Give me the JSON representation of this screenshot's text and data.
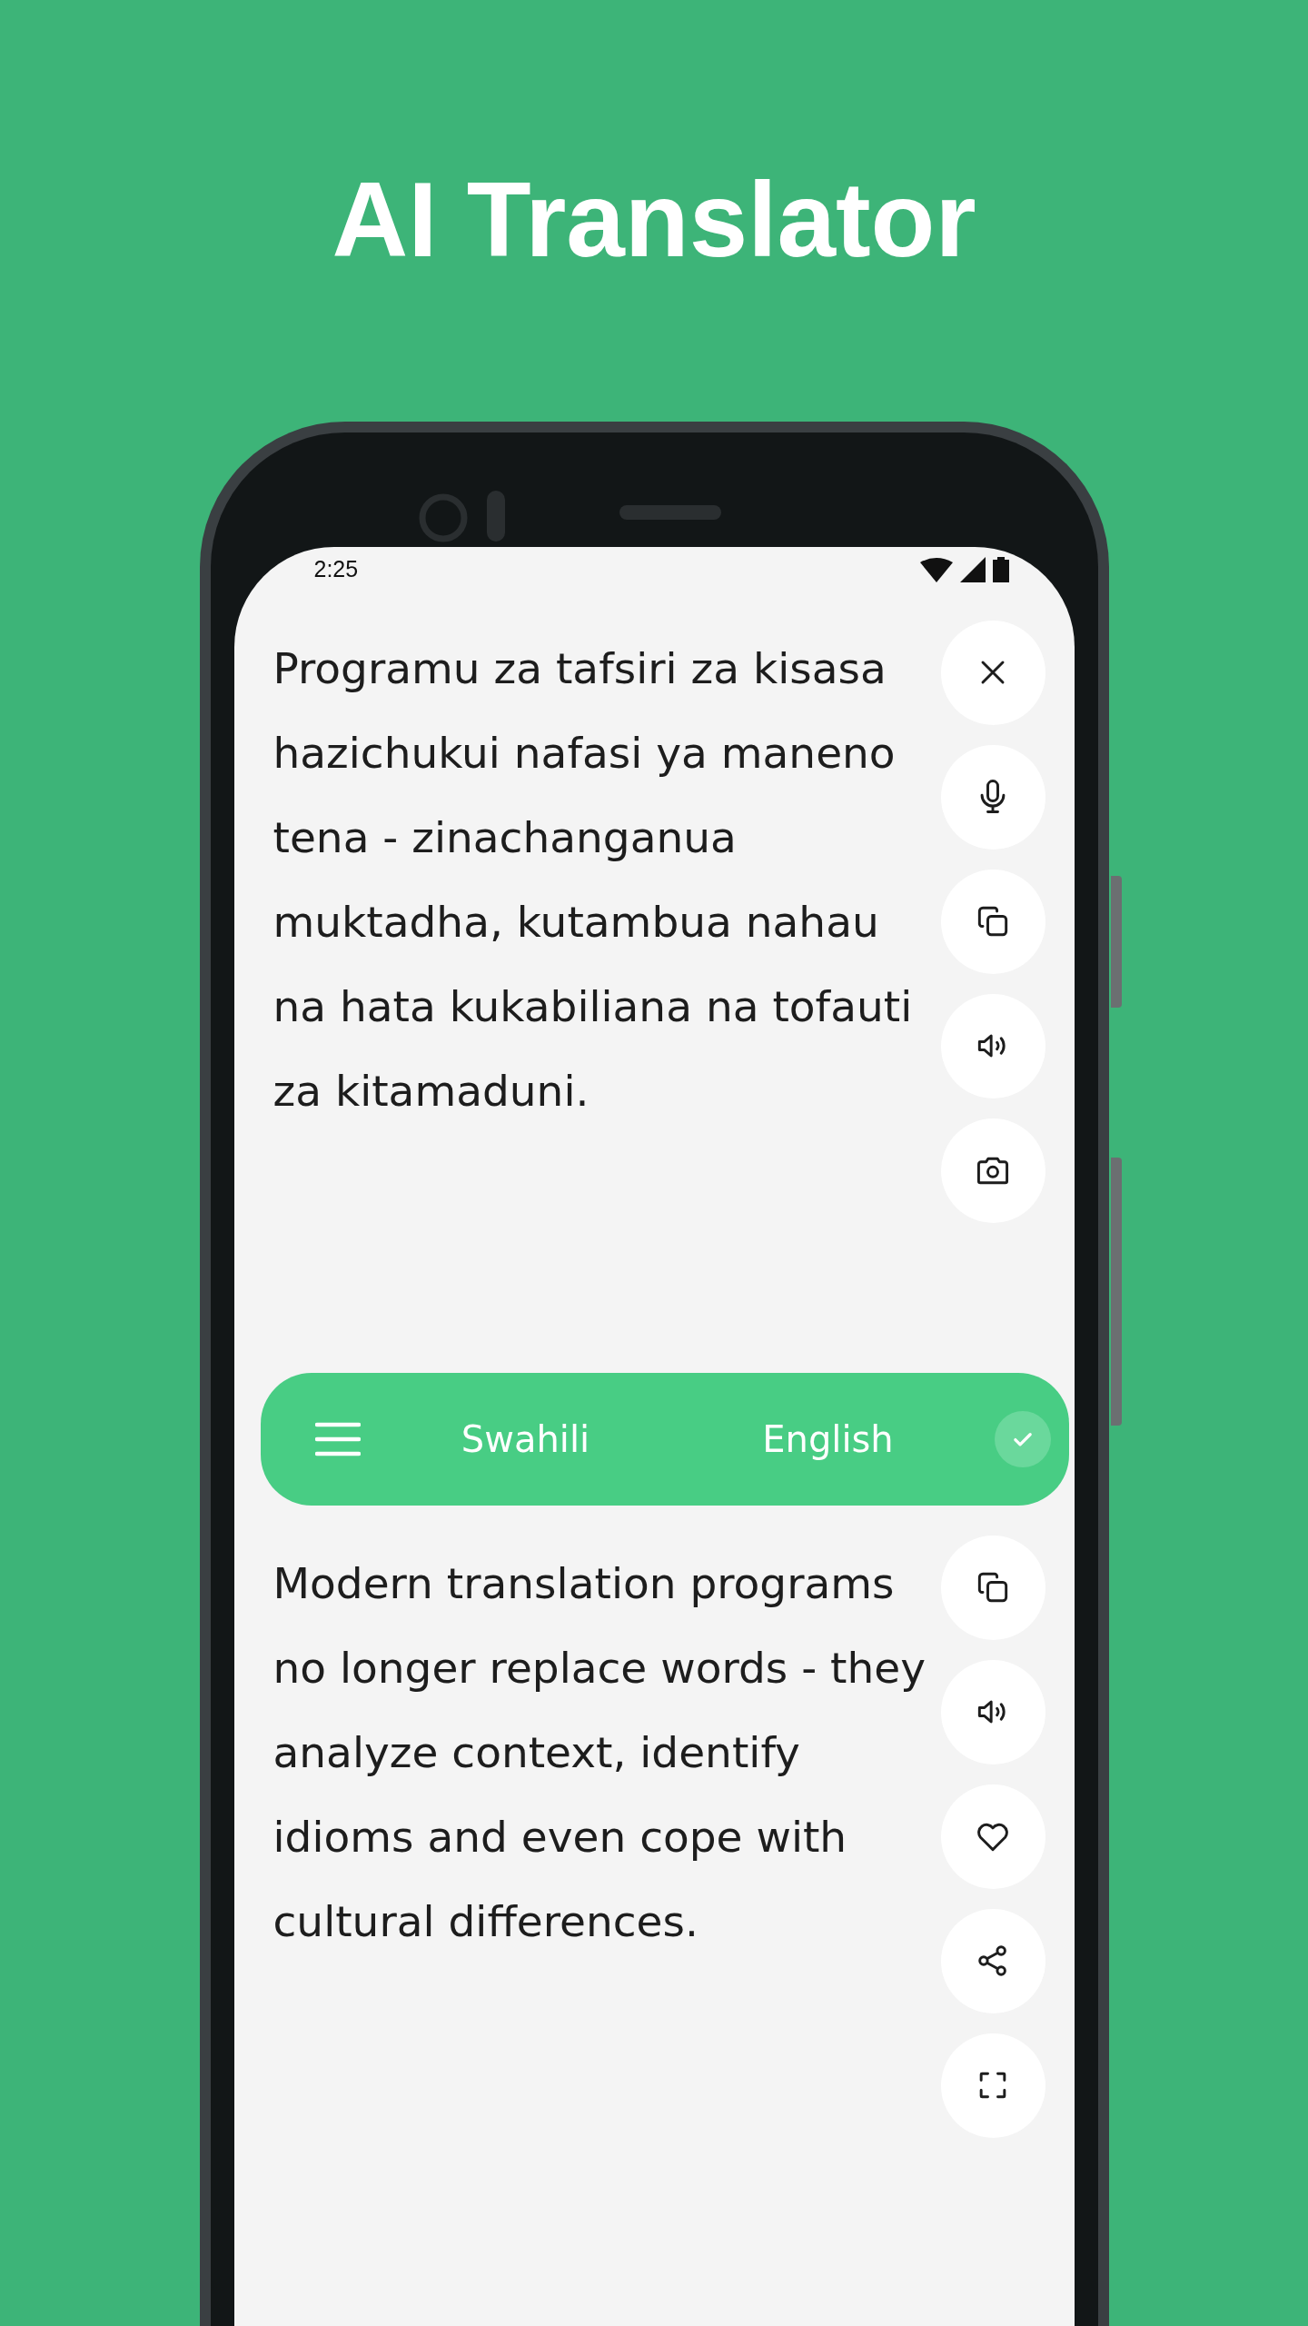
{
  "title": "AI Translator",
  "status_bar": {
    "time": "2:25"
  },
  "source": {
    "text": "Programu za tafsiri za kisasa hazichukui nafasi ya maneno tena - zinachanganua muktadha, kutambua nahau na hata kukabiliana na tofauti za kitamaduni."
  },
  "language_bar": {
    "source_language": "Swahili",
    "target_language": "English"
  },
  "translation": {
    "text": "Modern translation programs no longer replace words - they analyze context, identify idioms and even cope with cultural differences."
  }
}
